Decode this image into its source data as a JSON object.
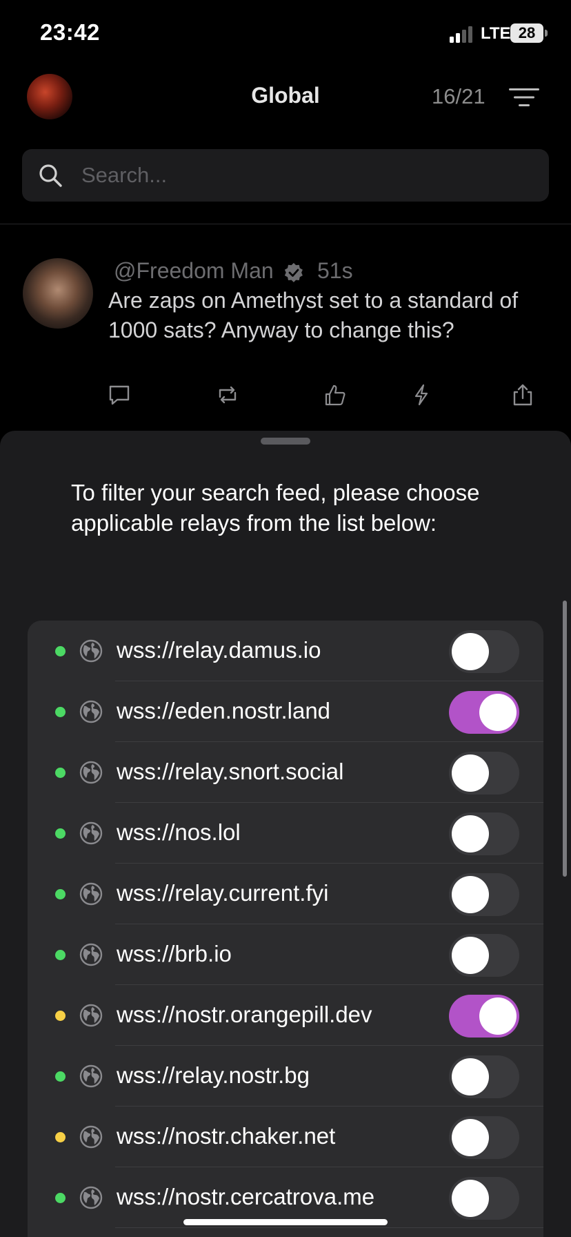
{
  "status_bar": {
    "time": "23:42",
    "network": "LTE",
    "battery": "28"
  },
  "header": {
    "title": "Global",
    "counter": "16/21"
  },
  "search": {
    "placeholder": "Search..."
  },
  "post": {
    "author": "@Freedom Man",
    "time": "51s",
    "text": "Are zaps on Amethyst set to a standard of 1000 sats? Anyway to change this?"
  },
  "sheet": {
    "instruction": "To filter your search feed, please choose applicable relays from the list below:"
  },
  "relays": [
    {
      "url": "wss://relay.damus.io",
      "status": "online",
      "enabled": false
    },
    {
      "url": "wss://eden.nostr.land",
      "status": "online",
      "enabled": true
    },
    {
      "url": "wss://relay.snort.social",
      "status": "online",
      "enabled": false
    },
    {
      "url": "wss://nos.lol",
      "status": "online",
      "enabled": false
    },
    {
      "url": "wss://relay.current.fyi",
      "status": "online",
      "enabled": false
    },
    {
      "url": "wss://brb.io",
      "status": "online",
      "enabled": false
    },
    {
      "url": "wss://nostr.orangepill.dev",
      "status": "slow",
      "enabled": true
    },
    {
      "url": "wss://relay.nostr.bg",
      "status": "online",
      "enabled": false
    },
    {
      "url": "wss://nostr.chaker.net",
      "status": "slow",
      "enabled": false
    },
    {
      "url": "wss://nostr.cercatrova.me",
      "status": "online",
      "enabled": false
    }
  ],
  "colors": {
    "accent": "#b253c8",
    "online": "#4cd964",
    "slow": "#f7d046"
  }
}
